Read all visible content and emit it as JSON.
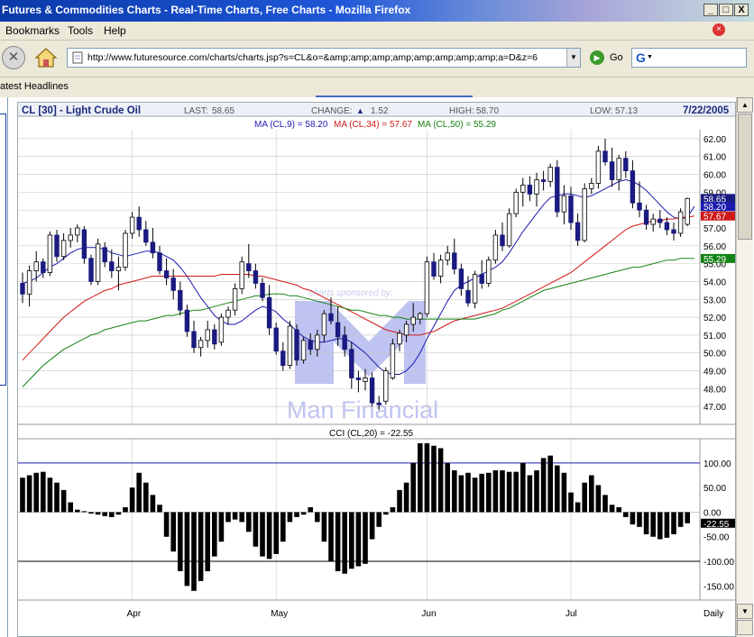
{
  "window": {
    "title": "Futures & Commodities Charts - Real-Time Charts, Free Charts - Mozilla Firefox",
    "min_label": "_",
    "max_label": "□",
    "close_label": "X"
  },
  "menu": {
    "items": [
      "Bookmarks",
      "Tools",
      "Help"
    ]
  },
  "nav": {
    "url": "http://www.futuresource.com/charts/charts.jsp?s=CL&o=&amp;amp;amp;amp;amp;amp;amp;amp;a=D&z=6",
    "go_label": "Go",
    "search_value": "G"
  },
  "bookmarks": {
    "item": "atest Headlines"
  },
  "colors": {
    "ma9": "#1a1ab0",
    "ma34": "#d01818",
    "ma50": "#148214",
    "header_text": "#1a2a7a",
    "grid": "#c8c8c8"
  },
  "icons": {
    "stop": "stop-icon",
    "home": "home-icon",
    "page": "page-icon",
    "go": "go-arrow-icon",
    "google": "google-icon"
  },
  "chart_header": {
    "symbol": "CL [30] - Light Crude Oil",
    "last_label": "LAST:",
    "last": "58.65",
    "change_label": "CHANGE:",
    "change_arrow": "▲",
    "change": "1.52",
    "high_label": "HIGH:",
    "high": "58.70",
    "low_label": "LOW:",
    "low": "57.13",
    "date": "7/22/2005"
  },
  "ma_legend": {
    "ma9": "MA (CL,9) = 58.20",
    "ma34": "MA (CL,34) = 57.67",
    "ma50": "MA (CL,50) = 55.29"
  },
  "cci_legend": "CCI (CL,20) = -22.55",
  "watermark": {
    "line1": "charts sponsored by:",
    "line2": "Man Financial"
  },
  "chart_data": [
    {
      "type": "candlestick",
      "title": "CL [30] - Light Crude Oil",
      "ylim": [
        46,
        62.5
      ],
      "yticks": [
        "62.00",
        "61.00",
        "60.00",
        "59.00",
        "58.00",
        "57.00",
        "56.00",
        "55.00",
        "54.00",
        "53.00",
        "52.00",
        "51.00",
        "50.00",
        "49.00",
        "48.00",
        "47.00"
      ],
      "x_labels": [
        {
          "label": "Apr",
          "index": 16
        },
        {
          "label": "May",
          "index": 37
        },
        {
          "label": "Jun",
          "index": 59
        },
        {
          "label": "Jul",
          "index": 80
        },
        {
          "label": "Daily",
          "index": 98
        }
      ],
      "ohlc": [
        [
          53.9,
          54.5,
          52.8,
          53.3
        ],
        [
          53.3,
          54.9,
          52.6,
          54.6
        ],
        [
          54.6,
          55.7,
          54.0,
          55.1
        ],
        [
          55.1,
          55.3,
          54.2,
          54.5
        ],
        [
          54.5,
          56.8,
          54.3,
          56.6
        ],
        [
          56.6,
          56.9,
          55.1,
          55.4
        ],
        [
          55.4,
          56.7,
          55.2,
          56.3
        ],
        [
          56.3,
          57.0,
          55.9,
          56.6
        ],
        [
          56.6,
          57.2,
          56.2,
          57.0
        ],
        [
          56.9,
          57.1,
          55.0,
          55.3
        ],
        [
          55.3,
          55.5,
          53.8,
          54.0
        ],
        [
          54.0,
          56.4,
          53.8,
          56.1
        ],
        [
          55.9,
          56.2,
          54.8,
          55.1
        ],
        [
          55.1,
          55.8,
          54.2,
          54.6
        ],
        [
          54.6,
          55.4,
          53.5,
          54.8
        ],
        [
          54.8,
          56.9,
          54.6,
          56.7
        ],
        [
          56.7,
          57.9,
          56.4,
          57.6
        ],
        [
          57.6,
          58.2,
          56.5,
          56.9
        ],
        [
          56.9,
          57.4,
          56.0,
          56.2
        ],
        [
          56.2,
          57.0,
          55.3,
          55.6
        ],
        [
          55.6,
          56.0,
          54.4,
          54.6
        ],
        [
          54.6,
          55.3,
          53.8,
          54.2
        ],
        [
          54.2,
          54.7,
          53.0,
          53.5
        ],
        [
          53.5,
          54.0,
          52.1,
          52.4
        ],
        [
          52.4,
          52.7,
          50.9,
          51.2
        ],
        [
          51.2,
          51.8,
          50.0,
          50.3
        ],
        [
          50.3,
          50.9,
          49.8,
          50.7
        ],
        [
          50.7,
          51.8,
          50.3,
          51.3
        ],
        [
          51.3,
          51.6,
          50.2,
          50.5
        ],
        [
          50.6,
          52.2,
          50.4,
          52.0
        ],
        [
          52.0,
          52.6,
          51.6,
          52.4
        ],
        [
          52.4,
          53.9,
          52.1,
          53.6
        ],
        [
          53.6,
          55.4,
          53.3,
          55.1
        ],
        [
          55.0,
          56.1,
          54.2,
          54.6
        ],
        [
          54.6,
          55.0,
          53.6,
          53.9
        ],
        [
          53.9,
          54.2,
          52.9,
          53.1
        ],
        [
          53.1,
          53.8,
          51.0,
          51.4
        ],
        [
          51.4,
          51.7,
          49.9,
          50.1
        ],
        [
          50.1,
          50.6,
          49.0,
          49.3
        ],
        [
          49.3,
          51.8,
          49.1,
          51.5
        ],
        [
          51.3,
          51.6,
          49.3,
          49.6
        ],
        [
          49.6,
          50.9,
          49.4,
          50.7
        ],
        [
          50.7,
          51.1,
          49.9,
          50.2
        ],
        [
          50.2,
          51.3,
          49.8,
          51.0
        ],
        [
          51.0,
          52.4,
          50.6,
          52.2
        ],
        [
          52.2,
          53.1,
          51.6,
          51.8
        ],
        [
          51.7,
          52.6,
          50.4,
          50.9
        ],
        [
          51.0,
          51.5,
          49.8,
          50.2
        ],
        [
          50.2,
          50.6,
          48.0,
          48.6
        ],
        [
          48.6,
          49.0,
          47.8,
          48.5
        ],
        [
          48.4,
          49.1,
          47.9,
          48.6
        ],
        [
          48.6,
          48.9,
          47.0,
          47.2
        ],
        [
          47.2,
          47.6,
          46.8,
          47.1
        ],
        [
          47.3,
          49.2,
          47.1,
          49.0
        ],
        [
          48.6,
          50.8,
          48.5,
          50.5
        ],
        [
          50.5,
          51.3,
          50.1,
          51.1
        ],
        [
          51.0,
          51.8,
          50.6,
          51.6
        ],
        [
          51.6,
          52.8,
          51.2,
          52.0
        ],
        [
          51.9,
          52.3,
          51.6,
          52.2
        ],
        [
          52.2,
          55.4,
          52.0,
          55.1
        ],
        [
          55.1,
          55.6,
          54.1,
          54.3
        ],
        [
          54.3,
          55.5,
          53.9,
          55.2
        ],
        [
          55.2,
          56.0,
          54.9,
          55.6
        ],
        [
          55.6,
          56.4,
          54.4,
          54.7
        ],
        [
          54.7,
          55.0,
          53.2,
          53.6
        ],
        [
          53.5,
          54.3,
          52.6,
          52.8
        ],
        [
          52.8,
          54.6,
          52.5,
          54.4
        ],
        [
          54.4,
          55.2,
          53.6,
          53.9
        ],
        [
          53.9,
          55.4,
          53.7,
          55.2
        ],
        [
          55.2,
          56.9,
          55.0,
          56.6
        ],
        [
          56.6,
          57.3,
          55.7,
          56.0
        ],
        [
          56.0,
          58.1,
          55.9,
          57.8
        ],
        [
          57.8,
          59.2,
          57.6,
          59.0
        ],
        [
          59.0,
          59.8,
          58.2,
          59.4
        ],
        [
          59.4,
          59.9,
          58.5,
          58.9
        ],
        [
          58.9,
          60.1,
          58.2,
          59.7
        ],
        [
          59.7,
          60.2,
          59.1,
          59.6
        ],
        [
          59.6,
          60.6,
          59.3,
          60.4
        ],
        [
          60.4,
          60.8,
          57.6,
          57.9
        ],
        [
          57.9,
          59.4,
          57.2,
          58.8
        ],
        [
          58.8,
          59.3,
          56.9,
          57.3
        ],
        [
          57.3,
          57.8,
          56.0,
          56.3
        ],
        [
          56.3,
          59.5,
          56.2,
          59.2
        ],
        [
          59.2,
          59.8,
          58.9,
          59.5
        ],
        [
          59.5,
          61.6,
          59.2,
          61.3
        ],
        [
          61.3,
          62.0,
          60.5,
          60.7
        ],
        [
          60.7,
          61.5,
          59.3,
          59.7
        ],
        [
          59.7,
          61.1,
          59.1,
          60.9
        ],
        [
          60.9,
          61.3,
          59.8,
          60.2
        ],
        [
          60.2,
          60.8,
          58.1,
          58.4
        ],
        [
          58.4,
          59.6,
          57.6,
          58.0
        ],
        [
          58.0,
          58.3,
          56.9,
          57.2
        ],
        [
          57.2,
          57.8,
          56.8,
          57.5
        ],
        [
          57.5,
          58.0,
          57.0,
          57.3
        ],
        [
          57.3,
          57.6,
          56.6,
          56.9
        ],
        [
          56.9,
          57.3,
          56.3,
          56.7
        ],
        [
          56.7,
          58.1,
          56.5,
          57.9
        ],
        [
          57.2,
          58.7,
          57.1,
          58.65
        ]
      ],
      "series": [
        {
          "name": "MA (CL,9)",
          "values": [
            53.9,
            54.0,
            54.2,
            54.5,
            54.8,
            55.0,
            55.3,
            55.6,
            55.8,
            55.9,
            55.9,
            55.9,
            55.8,
            55.6,
            55.5,
            55.4,
            55.5,
            55.6,
            55.7,
            55.7,
            55.6,
            55.4,
            55.2,
            54.8,
            54.3,
            53.7,
            53.1,
            52.6,
            52.1,
            51.8,
            51.6,
            51.6,
            51.8,
            52.1,
            52.4,
            52.6,
            52.5,
            52.3,
            51.9,
            51.6,
            51.2,
            50.9,
            50.7,
            50.6,
            50.6,
            50.7,
            50.8,
            50.8,
            50.6,
            50.3,
            50.0,
            49.6,
            49.2,
            48.9,
            48.8,
            48.8,
            49.0,
            49.4,
            50.0,
            50.8,
            51.5,
            52.2,
            52.9,
            53.5,
            53.8,
            54.0,
            54.2,
            54.4,
            54.6,
            54.8,
            55.1,
            55.6,
            56.2,
            56.8,
            57.3,
            57.8,
            58.3,
            58.7,
            58.8,
            58.9,
            58.9,
            58.8,
            58.7,
            58.8,
            59.0,
            59.2,
            59.4,
            59.6,
            59.7,
            59.6,
            59.4,
            59.1,
            58.7,
            58.3,
            57.9,
            57.6,
            57.5,
            57.6,
            58.2
          ]
        },
        {
          "name": "MA (CL,34)",
          "values": [
            49.6,
            50.0,
            50.4,
            50.8,
            51.2,
            51.6,
            52.0,
            52.3,
            52.6,
            52.9,
            53.1,
            53.3,
            53.5,
            53.6,
            53.8,
            53.9,
            54.0,
            54.1,
            54.2,
            54.3,
            54.3,
            54.3,
            54.3,
            54.3,
            54.3,
            54.3,
            54.3,
            54.3,
            54.3,
            54.4,
            54.4,
            54.4,
            54.4,
            54.4,
            54.3,
            54.3,
            54.2,
            54.1,
            54.0,
            53.9,
            53.8,
            53.6,
            53.5,
            53.3,
            53.1,
            52.9,
            52.7,
            52.5,
            52.3,
            52.1,
            51.9,
            51.7,
            51.5,
            51.3,
            51.2,
            51.1,
            51.0,
            51.0,
            51.0,
            51.1,
            51.2,
            51.4,
            51.6,
            51.8,
            51.9,
            52.0,
            52.1,
            52.2,
            52.3,
            52.4,
            52.5,
            52.7,
            52.9,
            53.1,
            53.3,
            53.5,
            53.7,
            53.9,
            54.1,
            54.3,
            54.5,
            54.8,
            55.1,
            55.4,
            55.7,
            56.0,
            56.3,
            56.6,
            56.9,
            57.1,
            57.2,
            57.3,
            57.4,
            57.4,
            57.5,
            57.5,
            57.6,
            57.6,
            57.67
          ]
        },
        {
          "name": "MA (CL,50)",
          "values": [
            48.1,
            48.5,
            48.9,
            49.3,
            49.6,
            49.9,
            50.2,
            50.4,
            50.6,
            50.8,
            51.0,
            51.1,
            51.3,
            51.4,
            51.5,
            51.6,
            51.7,
            51.8,
            51.8,
            51.9,
            52.0,
            52.1,
            52.1,
            52.2,
            52.3,
            52.4,
            52.4,
            52.5,
            52.6,
            52.7,
            52.8,
            52.9,
            53.0,
            53.1,
            53.2,
            53.2,
            53.3,
            53.3,
            53.3,
            53.2,
            53.2,
            53.1,
            53.0,
            52.9,
            52.8,
            52.7,
            52.6,
            52.5,
            52.4,
            52.4,
            52.3,
            52.2,
            52.1,
            52.1,
            52.0,
            52.0,
            51.9,
            51.9,
            51.9,
            51.9,
            51.9,
            51.9,
            51.9,
            51.9,
            51.9,
            51.9,
            51.9,
            52.0,
            52.1,
            52.2,
            52.4,
            52.5,
            52.7,
            52.9,
            53.1,
            53.3,
            53.5,
            53.6,
            53.7,
            53.8,
            53.9,
            54.0,
            54.1,
            54.2,
            54.3,
            54.4,
            54.5,
            54.6,
            54.7,
            54.8,
            54.8,
            54.9,
            55.0,
            55.1,
            55.2,
            55.2,
            55.3,
            55.3,
            55.29
          ]
        }
      ],
      "value_tags": [
        {
          "name": "Last",
          "value": "58.65",
          "color": "#1a1a80"
        },
        {
          "name": "MA (CL,9)",
          "value": "58.20",
          "color": "#1a1ab0"
        },
        {
          "name": "MA (CL,34)",
          "value": "57.67",
          "color": "#d01818"
        },
        {
          "name": "MA (CL,50)",
          "value": "55.29",
          "color": "#148214"
        }
      ]
    },
    {
      "type": "bar",
      "title": "CCI (CL,20) = -22.55",
      "ylim": [
        -175,
        140
      ],
      "yticks": [
        "100.00",
        "50.00",
        "0.00",
        "-50.00",
        "-100.00",
        "-150.00"
      ],
      "reference_lines": [
        100,
        -100
      ],
      "last_tag": "-22.55",
      "values": [
        70,
        75,
        80,
        82,
        70,
        60,
        45,
        20,
        5,
        2,
        -3,
        -5,
        -8,
        -10,
        -5,
        10,
        50,
        80,
        60,
        35,
        15,
        -50,
        -80,
        -120,
        -150,
        -160,
        -140,
        -120,
        -90,
        -60,
        -20,
        -15,
        -20,
        -40,
        -70,
        -90,
        -95,
        -85,
        -60,
        -20,
        -10,
        -5,
        10,
        -20,
        -60,
        -100,
        -120,
        -125,
        -115,
        -110,
        -105,
        -55,
        -30,
        -5,
        10,
        45,
        60,
        100,
        140,
        140,
        135,
        130,
        100,
        85,
        75,
        80,
        70,
        78,
        80,
        85,
        85,
        82,
        82,
        100,
        75,
        85,
        110,
        115,
        95,
        80,
        40,
        20,
        60,
        75,
        55,
        35,
        15,
        10,
        -10,
        -25,
        -30,
        -45,
        -50,
        -55,
        -52,
        -45,
        -30,
        -22.55
      ]
    }
  ]
}
